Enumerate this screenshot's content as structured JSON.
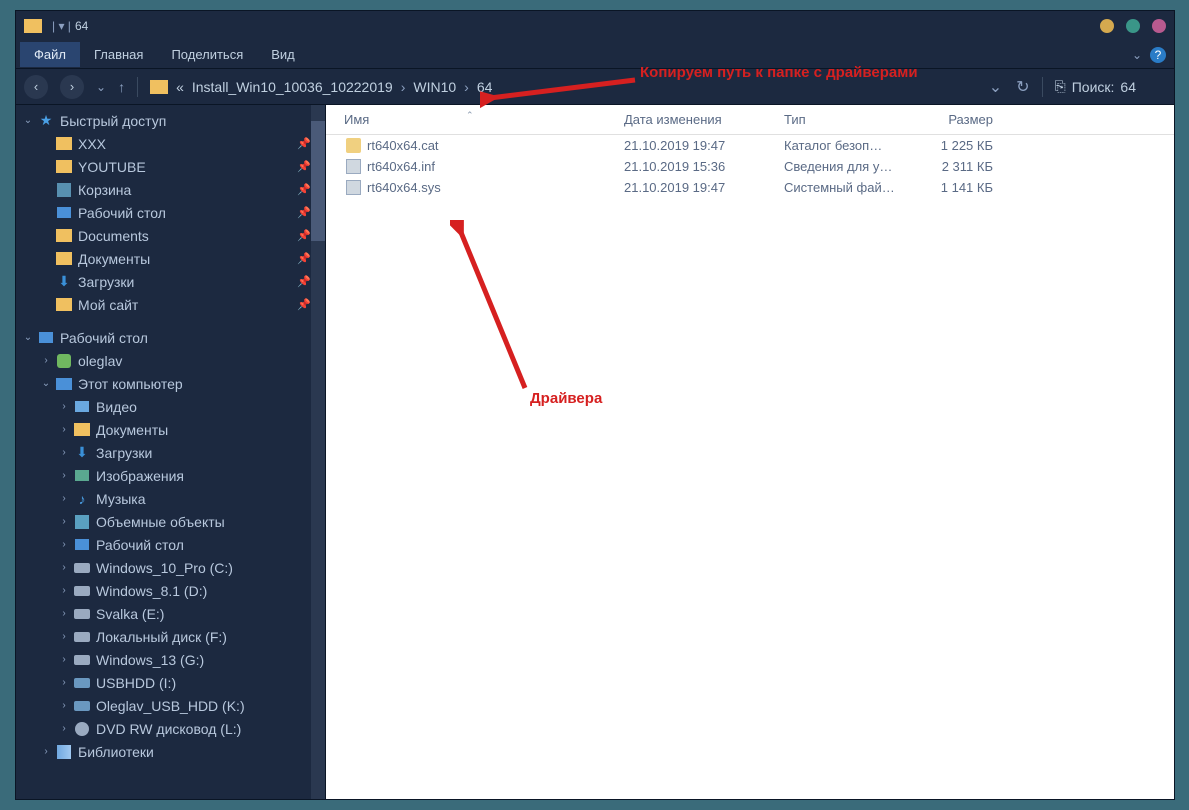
{
  "title": "64",
  "ribbon": {
    "file": "Файл",
    "tabs": [
      "Главная",
      "Поделиться",
      "Вид"
    ]
  },
  "breadcrumb": [
    "«",
    "Install_Win10_10036_10222019",
    "WIN10",
    "64"
  ],
  "search_label": "Поиск:",
  "search_value": "64",
  "columns": {
    "name": "Имя",
    "date": "Дата изменения",
    "type": "Тип",
    "size": "Размер"
  },
  "files": [
    {
      "name": "rt640x64.cat",
      "date": "21.10.2019 19:47",
      "type": "Каталог безоп…",
      "size": "1 225 КБ",
      "icon": "ico-cat"
    },
    {
      "name": "rt640x64.inf",
      "date": "21.10.2019 15:36",
      "type": "Сведения для у…",
      "size": "2 311 КБ",
      "icon": "ico-inf"
    },
    {
      "name": "rt640x64.sys",
      "date": "21.10.2019 19:47",
      "type": "Системный фай…",
      "size": "1 141 КБ",
      "icon": "ico-sys"
    }
  ],
  "sidebar": {
    "quick": {
      "label": "Быстрый доступ",
      "items": [
        "XXX",
        "YOUTUBE",
        "Корзина",
        "Рабочий стол",
        "Documents",
        "Документы",
        "Загрузки",
        "Мой сайт"
      ]
    },
    "desktop": {
      "label": "Рабочий стол",
      "user": "oleglav",
      "pc": {
        "label": "Этот компьютер",
        "folders": [
          "Видео",
          "Документы",
          "Загрузки",
          "Изображения",
          "Музыка",
          "Объемные объекты",
          "Рабочий стол"
        ],
        "drives": [
          "Windows_10_Pro (C:)",
          "Windows_8.1 (D:)",
          "Svalka (E:)",
          "Локальный диск (F:)",
          "Windows_13 (G:)",
          "USBHDD (I:)",
          "Oleglav_USB_HDD (K:)",
          "DVD RW дисковод (L:)"
        ]
      },
      "libs": "Библиотеки"
    }
  },
  "annotations": {
    "top": "Копируем путь к папке с драйверами",
    "mid": "Драйвера"
  }
}
